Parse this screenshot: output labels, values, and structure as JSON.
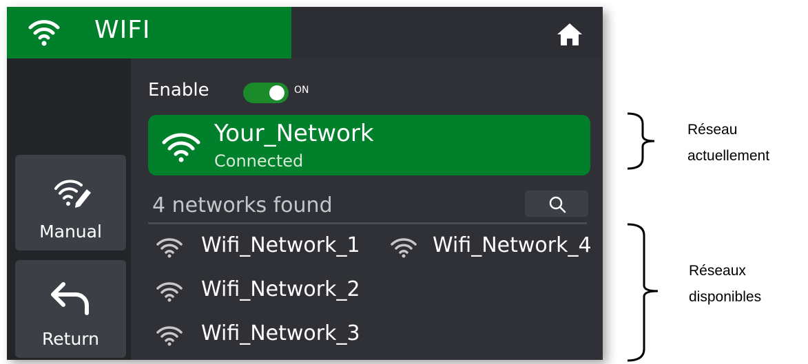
{
  "header": {
    "title": "WIFI",
    "wifi_icon": "wifi-icon",
    "home_icon": "home-icon"
  },
  "sidebar": {
    "manual": {
      "label": "Manual",
      "icon": "wifi-edit-icon"
    },
    "return": {
      "label": "Return",
      "icon": "return-arrow-icon"
    }
  },
  "enable": {
    "label": "Enable",
    "state": "ON",
    "on": true
  },
  "current_network": {
    "ssid": "Your_Network",
    "status": "Connected"
  },
  "networks_found": "4 networks found",
  "networks": [
    "Wifi_Network_1",
    "Wifi_Network_2",
    "Wifi_Network_3",
    "Wifi_Network_4"
  ],
  "annotations": {
    "current": [
      "Réseau",
      "actuellement"
    ],
    "available": [
      "Réseaux",
      "disponibles"
    ]
  },
  "colors": {
    "accent_green": "#00802b",
    "background": "#2f3137",
    "sidebar": "#222428",
    "button": "#3c3f46"
  }
}
